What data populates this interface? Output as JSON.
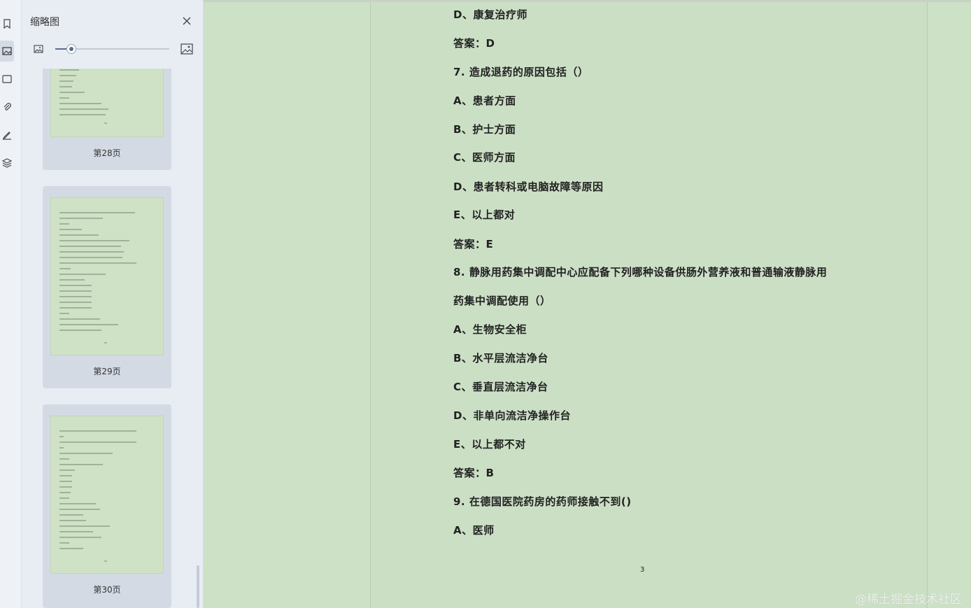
{
  "sidebar": {
    "title": "缩略图",
    "icons": [
      "bookmark-icon",
      "thumbnail-icon",
      "comment-icon",
      "attachment-icon",
      "signature-icon",
      "layers-icon"
    ]
  },
  "thumbnails": [
    {
      "label": "第28页"
    },
    {
      "label": "第29页"
    },
    {
      "label": "第30页"
    }
  ],
  "zoom": {
    "level": 0.15
  },
  "document": {
    "lines": [
      "D、康复治疗师",
      "答案：D",
      "7. 造成退药的原因包括（）",
      "A、患者方面",
      "B、护士方面",
      "C、医师方面",
      "D、患者转科或电脑故障等原因",
      "E、以上都对",
      "答案：E",
      "8. 静脉用药集中调配中心应配备下列哪种设备供肠外营养液和普通输液静脉用",
      "药集中调配使用（）",
      "A、生物安全柜",
      "B、水平层流洁净台",
      "C、垂直层流洁净台",
      "D、非单向流洁净操作台",
      "E、以上都不对",
      "答案：B",
      "9. 在德国医院药房的药师接触不到()",
      "A、医师"
    ],
    "page_number": "3"
  },
  "watermark": "@稀土掘金技术社区"
}
